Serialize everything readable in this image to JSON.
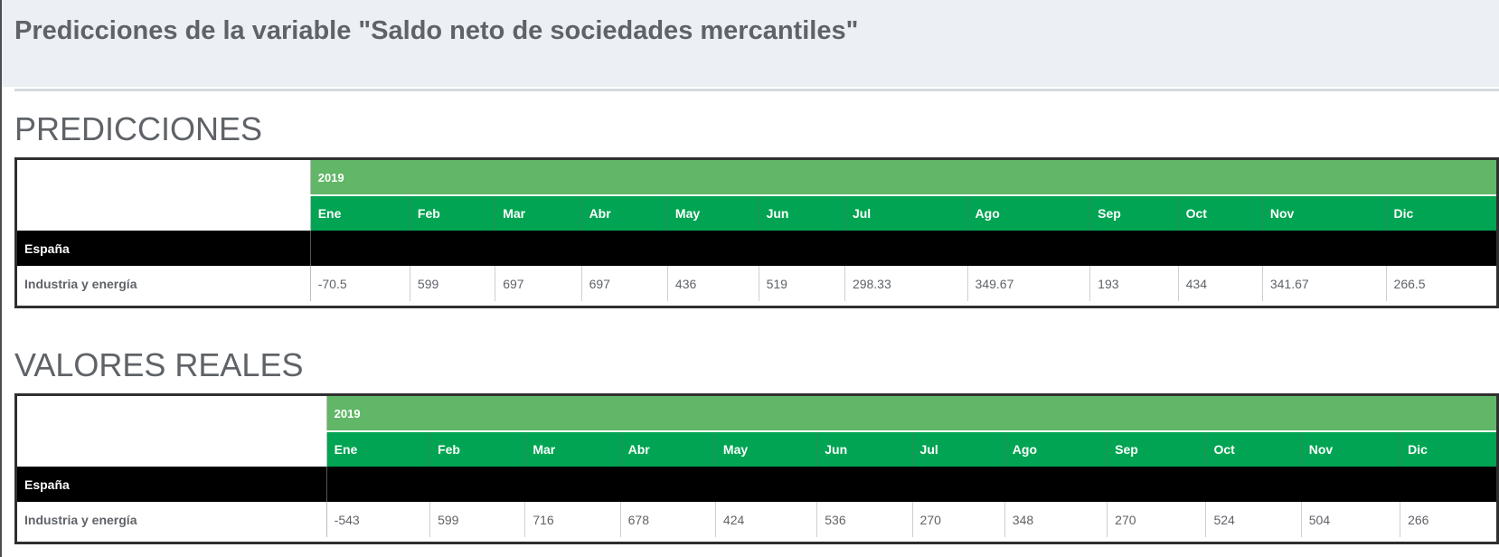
{
  "page": {
    "title": "Predicciones de la variable \"Saldo neto de sociedades mercantiles\""
  },
  "colors": {
    "year_header": "#62b667",
    "month_header": "#00a452",
    "region_row": "#000000",
    "text": "#5f6368"
  },
  "sections": [
    {
      "heading": "PREDICCIONES",
      "year": "2019",
      "months": [
        "Ene",
        "Feb",
        "Mar",
        "Abr",
        "May",
        "Jun",
        "Jul",
        "Ago",
        "Sep",
        "Oct",
        "Nov",
        "Dic"
      ],
      "region": "España",
      "row_label": "Industria y energía",
      "values": [
        "-70.5",
        "599",
        "697",
        "697",
        "436",
        "519",
        "298.33",
        "349.67",
        "193",
        "434",
        "341.67",
        "266.5"
      ]
    },
    {
      "heading": "VALORES REALES",
      "year": "2019",
      "months": [
        "Ene",
        "Feb",
        "Mar",
        "Abr",
        "May",
        "Jun",
        "Jul",
        "Ago",
        "Sep",
        "Oct",
        "Nov",
        "Dic"
      ],
      "region": "España",
      "row_label": "Industria y energía",
      "values": [
        "-543",
        "599",
        "716",
        "678",
        "424",
        "536",
        "270",
        "348",
        "270",
        "524",
        "504",
        "266"
      ]
    }
  ]
}
